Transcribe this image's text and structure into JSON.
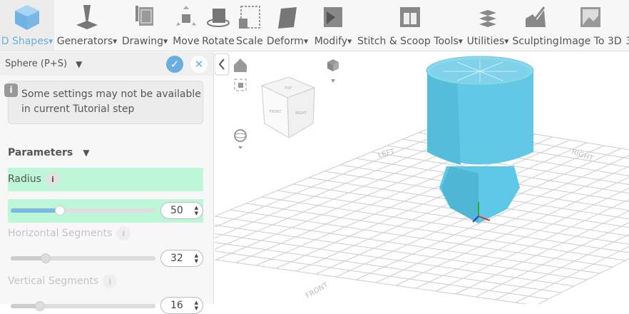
{
  "toolbar": {
    "items": [
      {
        "label": "D Shapes",
        "dropdown": true,
        "icon": "cube-icon"
      },
      {
        "label": "Generators",
        "dropdown": true,
        "icon": "generator-icon"
      },
      {
        "label": "Drawing",
        "dropdown": true,
        "icon": "drawing-icon"
      },
      {
        "label": "Move",
        "dropdown": false,
        "icon": "move-icon"
      },
      {
        "label": "Rotate",
        "dropdown": false,
        "icon": "rotate-icon"
      },
      {
        "label": "Scale",
        "dropdown": false,
        "icon": "scale-icon"
      },
      {
        "label": "Deform",
        "dropdown": true,
        "icon": "deform-icon"
      },
      {
        "label": "Modify",
        "dropdown": true,
        "icon": "modify-icon"
      },
      {
        "label": "Stitch & Scoop Tools",
        "dropdown": true,
        "icon": "stitch-scoop-icon"
      },
      {
        "label": "Utilities",
        "dropdown": true,
        "icon": "utilities-icon"
      },
      {
        "label": "Sculpting",
        "dropdown": false,
        "icon": "sculpting-icon"
      },
      {
        "label": "Image To 3D",
        "dropdown": false,
        "icon": "image-to-3d-icon"
      },
      {
        "label": "3",
        "dropdown": false
      }
    ]
  },
  "panel": {
    "title": "Sphere (P+S)",
    "note": "Some settings may not be available in current Tutorial step",
    "section": "Parameters",
    "params": [
      {
        "label": "Radius",
        "value": "50",
        "fraction": 0.34,
        "enabled": true
      },
      {
        "label": "Horizontal Segments",
        "value": "32",
        "fraction": 0.24,
        "enabled": false
      },
      {
        "label": "Vertical Segments",
        "value": "16",
        "fraction": 0.2,
        "enabled": false
      }
    ]
  },
  "viewport": {
    "cube_faces": {
      "top": "TOP",
      "front": "FRONT",
      "right": "RIGHT"
    },
    "grid_labels": {
      "left": "LEFT",
      "right": "RIGHT",
      "front": "FRONT"
    }
  },
  "colors": {
    "accent": "#6aaee0",
    "shape": "#5ec8e8",
    "highlight": "#bdf7d8"
  }
}
